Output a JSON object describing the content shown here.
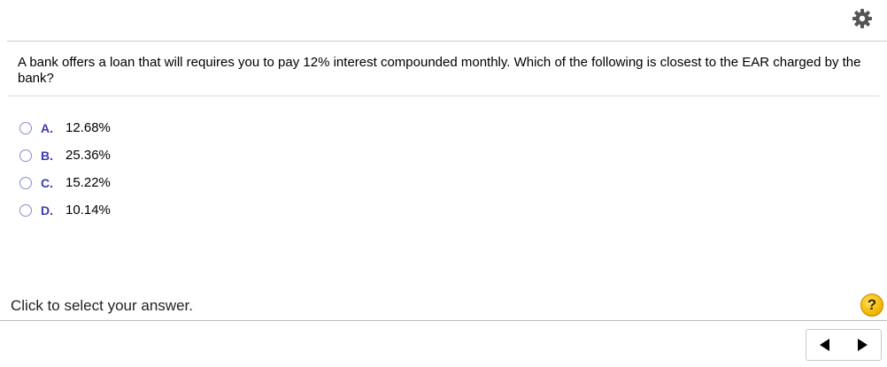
{
  "toolbar": {
    "settings_icon": "gear-icon"
  },
  "question": {
    "text": "A bank offers a loan that will requires you to pay 12% interest compounded monthly.  Which of the following is closest to the EAR charged by the bank?"
  },
  "options": [
    {
      "letter": "A.",
      "text": "12.68%"
    },
    {
      "letter": "B.",
      "text": "25.36%"
    },
    {
      "letter": "C.",
      "text": "15.22%"
    },
    {
      "letter": "D.",
      "text": "10.14%"
    }
  ],
  "footer": {
    "status": "Click to select your answer.",
    "help_label": "?",
    "prev_icon": "arrow-left-icon",
    "next_icon": "arrow-right-icon"
  },
  "colors": {
    "option_letter": "#3b3bb3",
    "radio_border": "#8a8ad0",
    "help_bg": "#f5b800"
  }
}
